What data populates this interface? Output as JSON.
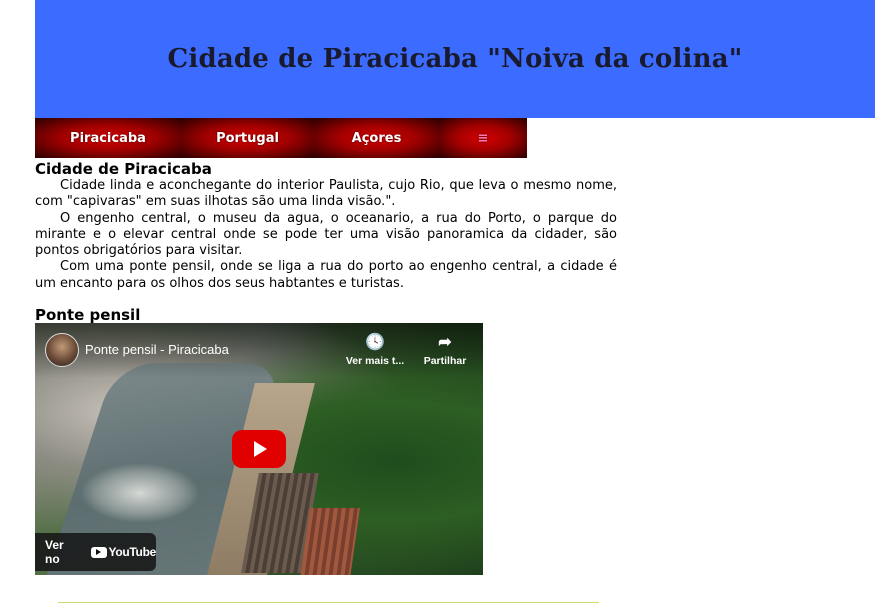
{
  "header": {
    "title": "Cidade de Piracicaba \"Noiva da colina\""
  },
  "nav": {
    "items": [
      "Piracicaba",
      "Portugal",
      "Açores",
      "≡"
    ]
  },
  "section1": {
    "heading": "Cidade de Piracicaba",
    "paragraphs": [
      "Cidade linda e aconchegante do interior Paulista, cujo Rio, que leva o mesmo nome, com \"capivaras\" em suas ilhotas são uma linda visão.\".",
      "O engenho central, o museu da agua, o oceanario, a rua do Porto, o parque do mirante e o elevar central onde se pode ter uma visão panoramica da cidader, são pontos obrigatórios para visitar.",
      "Com uma ponte pensil, onde se liga a rua do porto ao engenho central, a cidade é um encanto para os olhos dos seus habtantes e turistas."
    ]
  },
  "section2": {
    "heading": "Ponte pensil"
  },
  "video": {
    "title": "Ponte pensil - Piracicaba",
    "watch_later": "Ver mais t...",
    "share": "Partilhar",
    "watch_on": "Ver no",
    "platform": "YouTube"
  },
  "colors": {
    "header_bg": "#3b6cff",
    "nav_red": "#d40000",
    "play_red": "#e10000",
    "footer_line": "#c8dd6e"
  }
}
